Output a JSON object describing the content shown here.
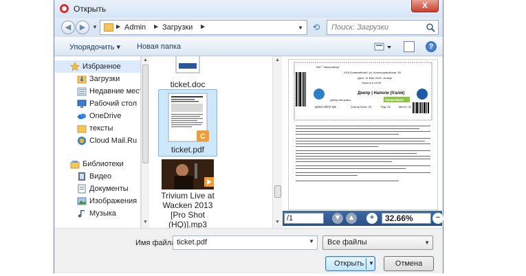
{
  "window": {
    "title": "Открыть",
    "close_label": "X"
  },
  "address": {
    "breadcrumbs": [
      "Admin",
      "Загрузки"
    ],
    "search_placeholder": "Поиск: Загрузки"
  },
  "toolbar": {
    "organize_label": "Упорядочить ▾",
    "new_folder_label": "Новая папка"
  },
  "sidebar": {
    "items": [
      {
        "label": "Избранное",
        "icon": "star-icon"
      },
      {
        "label": "Загрузки",
        "icon": "downloads-folder-icon"
      },
      {
        "label": "Недавние места",
        "icon": "recent-places-icon"
      },
      {
        "label": "Рабочий стол",
        "icon": "desktop-icon"
      },
      {
        "label": "OneDrive",
        "icon": "onedrive-icon"
      },
      {
        "label": "тексты",
        "icon": "folder-icon"
      },
      {
        "label": "Cloud Mail.Ru",
        "icon": "cloud-mail-icon"
      },
      {
        "label": "Библиотеки",
        "icon": "libraries-icon"
      },
      {
        "label": "Видео",
        "icon": "video-library-icon"
      },
      {
        "label": "Документы",
        "icon": "documents-library-icon"
      },
      {
        "label": "Изображения",
        "icon": "images-library-icon"
      },
      {
        "label": "Музыка",
        "icon": "music-library-icon"
      }
    ]
  },
  "files": [
    {
      "name": "ticket.doc",
      "selected": false
    },
    {
      "name": "ticket.pdf",
      "selected": true
    },
    {
      "name": "Trivium Live at Wacken 2013 [Pro Shot (HQ)].mp3",
      "lines": [
        "Trivium Live at",
        "Wacken 2013",
        "[Pro Shot",
        "(HQ)].mp3"
      ],
      "selected": false
    }
  ],
  "preview": {
    "page_field": "/1",
    "zoom": "32.66%",
    "ticket": {
      "header_code": "КАС \"Запорожець\"",
      "address": "НСК Олимпийский, ул. Красноармейская, 55",
      "date": "Дата: 14 Мая 2015, четверг",
      "time": "Начало в 19:30",
      "match": "Днепр | Наполи (Італія)",
      "section": "Днепропетровск",
      "price": "Цена 100,0 грн",
      "sector": "Сектор Блок: 26",
      "row": "Ряд: 26",
      "seat": "Место: 22",
      "sponsor": "ПриватБанк"
    }
  },
  "footer": {
    "filename_label": "Имя файла:",
    "filename_value": "ticket.pdf",
    "filetype_value": "Все файлы",
    "open_label": "Открыть",
    "cancel_label": "Отмена"
  }
}
